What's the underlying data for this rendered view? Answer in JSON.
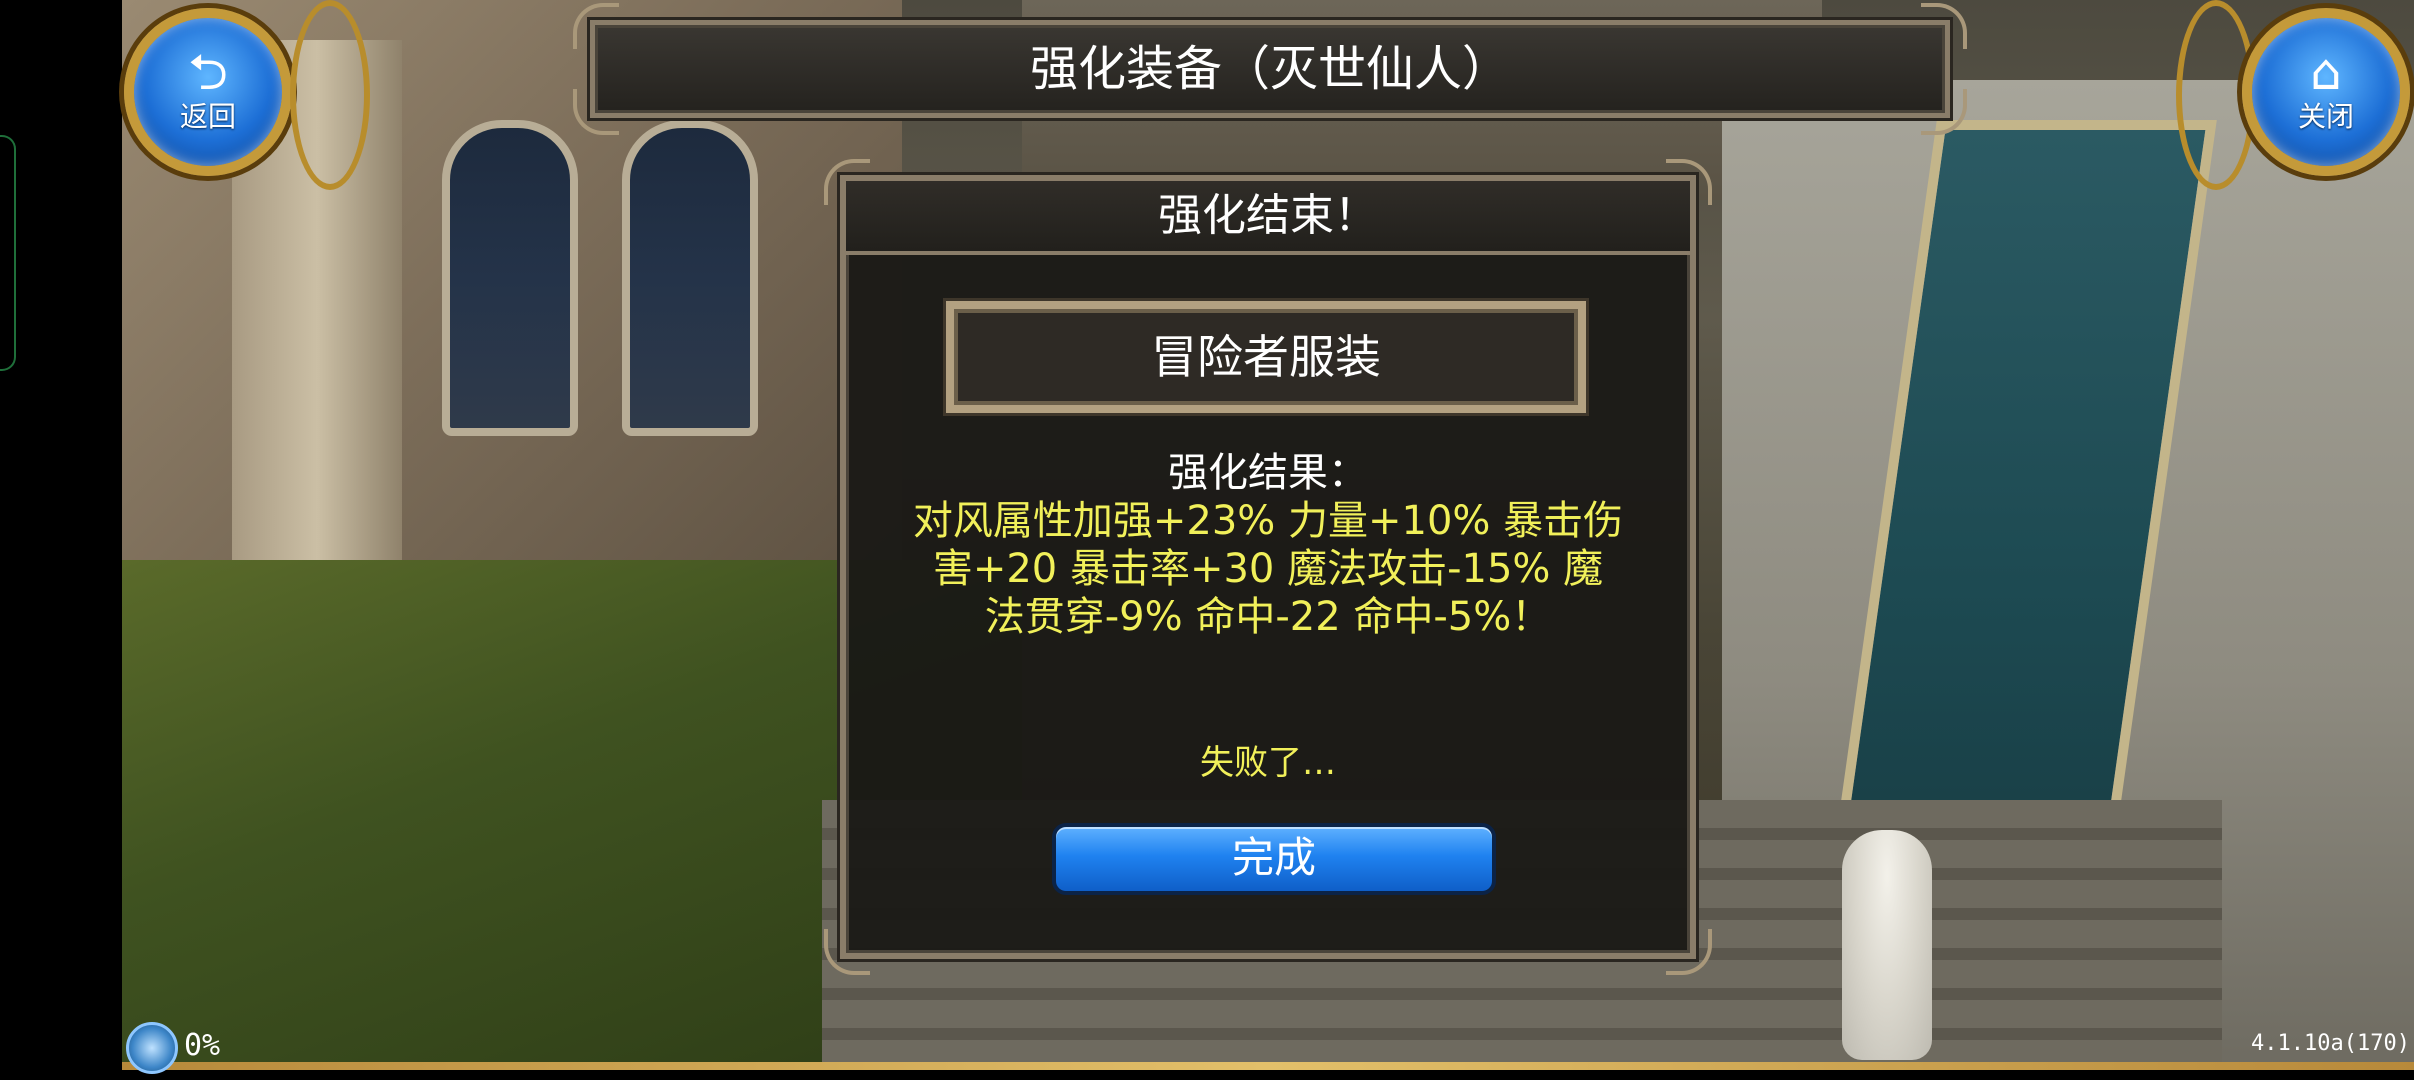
{
  "title_bar": {
    "title": "强化装备（灭世仙人）"
  },
  "nav": {
    "back_label": "返回",
    "back_icon": "return-arrow-icon",
    "close_label": "关闭",
    "close_icon": "home-icon"
  },
  "dialog": {
    "header": "强化结束！",
    "item_name": "冒险者服装",
    "result_heading": "强化结果：",
    "result_line1": "对风属性加强+23% 力量+10% 暴击伤",
    "result_line2": "害+20 暴击率+30 魔法攻击-15% 魔",
    "result_line3": "法贯穿-9% 命中-22 命中-5%！",
    "status": "失败了…",
    "done_label": "完成"
  },
  "status_bar": {
    "loading_percent": "0%",
    "version": "4.1.10a(170)"
  },
  "colors": {
    "result_text": "#f1f05a",
    "button_blue": "#1f82f0",
    "frame": "#8a7d69",
    "gold": "#c49a3a"
  }
}
